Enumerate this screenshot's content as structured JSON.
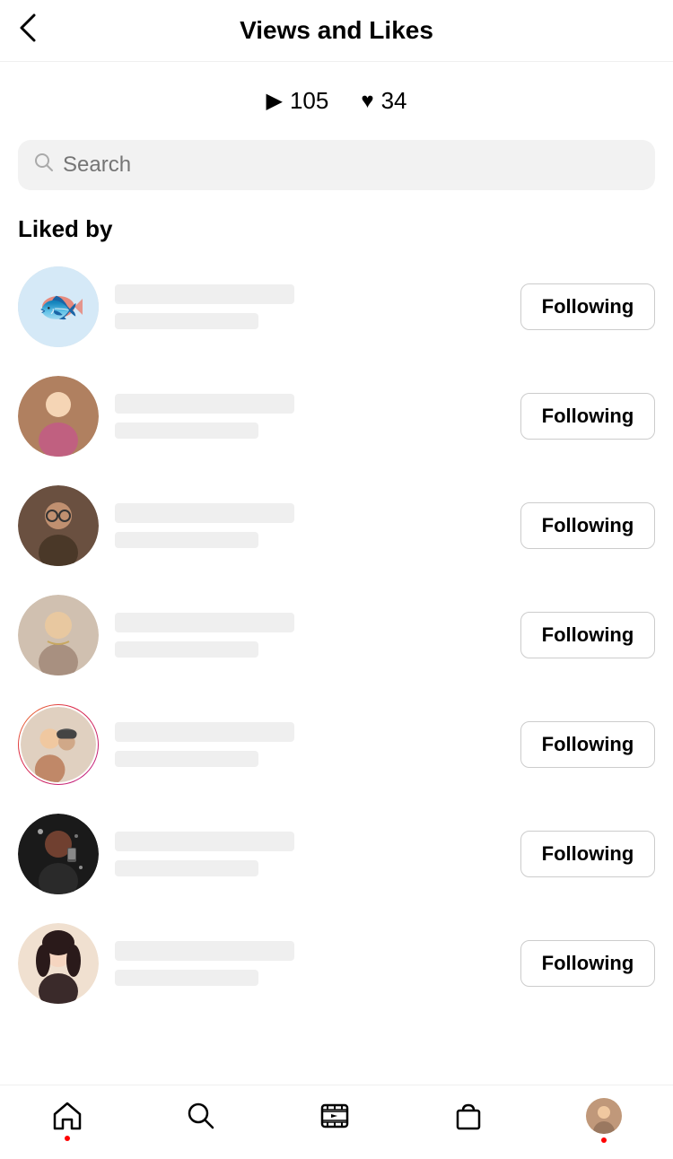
{
  "header": {
    "back_label": "‹",
    "title": "Views and Likes"
  },
  "stats": {
    "views_icon": "▶",
    "views_count": "105",
    "likes_icon": "♥",
    "likes_count": "34"
  },
  "search": {
    "placeholder": "Search"
  },
  "liked_by": {
    "label": "Liked by"
  },
  "users": [
    {
      "id": 1,
      "following_label": "Following",
      "has_story": false,
      "has_plain_ring": true,
      "avatar_color": "#d0e8f5",
      "avatar_type": "fish"
    },
    {
      "id": 2,
      "following_label": "Following",
      "has_story": false,
      "has_plain_ring": false,
      "avatar_color": "#a0806a",
      "avatar_type": "person2"
    },
    {
      "id": 3,
      "following_label": "Following",
      "has_story": false,
      "has_plain_ring": false,
      "avatar_color": "#7a6050",
      "avatar_type": "person3"
    },
    {
      "id": 4,
      "following_label": "Following",
      "has_story": false,
      "has_plain_ring": false,
      "avatar_color": "#c0b0a0",
      "avatar_type": "person4"
    },
    {
      "id": 5,
      "following_label": "Following",
      "has_story": true,
      "has_plain_ring": false,
      "avatar_color": "#e0c8b0",
      "avatar_type": "person5"
    },
    {
      "id": 6,
      "following_label": "Following",
      "has_story": false,
      "has_plain_ring": false,
      "avatar_color": "#1a1a1a",
      "avatar_type": "person6"
    },
    {
      "id": 7,
      "following_label": "Following",
      "has_story": false,
      "has_plain_ring": false,
      "avatar_color": "#f0d8c0",
      "avatar_type": "person7"
    }
  ],
  "bottom_nav": {
    "home_icon": "⌂",
    "search_icon": "○",
    "reels_icon": "▷",
    "shop_icon": "◻",
    "profile_icon": "avatar"
  }
}
